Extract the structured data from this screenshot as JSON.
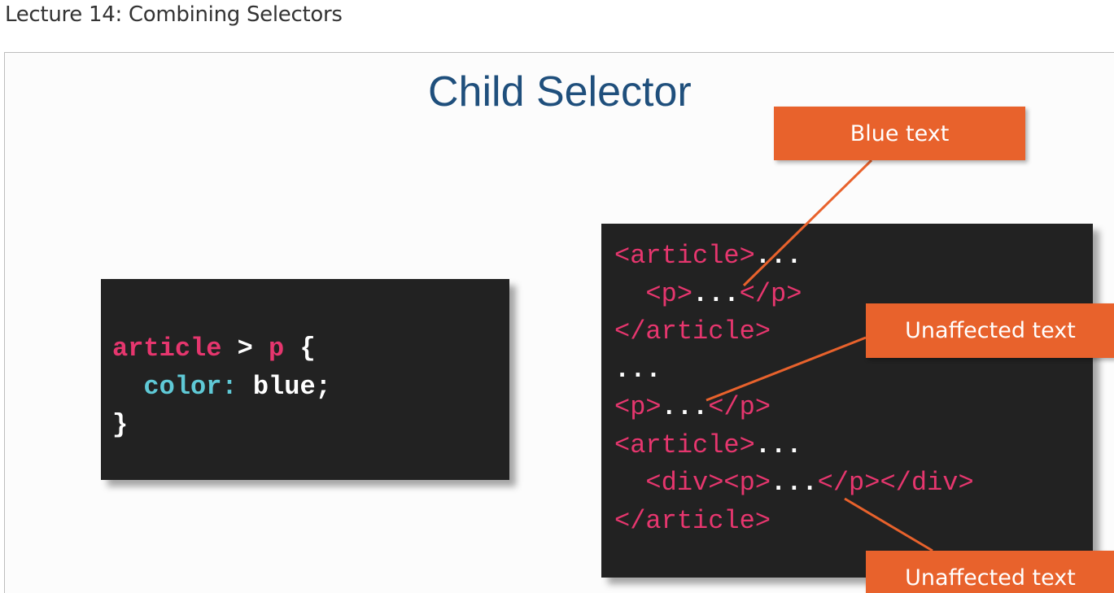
{
  "page": {
    "lecture_title": "Lecture 14: Combining Selectors"
  },
  "slide": {
    "title": "Child Selector",
    "css_code": {
      "line1": {
        "selector": "article",
        "combinator": " > ",
        "target": "p",
        "brace_open": " {"
      },
      "line2": {
        "indent": "  ",
        "property": "color:",
        "value": " blue;"
      },
      "line3": {
        "brace_close": "}"
      }
    },
    "html_code": {
      "line1": {
        "tag": "<article>",
        "text": "..."
      },
      "line2": {
        "indent": "  ",
        "open": "<p>",
        "text": "...",
        "close": "</p>"
      },
      "line3": {
        "tag": "</article>"
      },
      "line4": {
        "text": "..."
      },
      "line5": {
        "open": "<p>",
        "text": "...",
        "close": "</p>"
      },
      "line6": {
        "tag": "<article>",
        "text": "..."
      },
      "line7": {
        "indent": "  ",
        "open": "<div><p>",
        "text": "...",
        "close": "</p></div>"
      },
      "line8": {
        "tag": "</article>"
      }
    },
    "callouts": {
      "blue_text": "Blue text",
      "unaffected_1": "Unaffected text",
      "unaffected_2": "Unaffected text"
    },
    "colors": {
      "title": "#1f4f7c",
      "code_background": "#222222",
      "selector_pink": "#e6366e",
      "property_cyan": "#5fc9d6",
      "callout_orange": "#e8622c"
    }
  }
}
